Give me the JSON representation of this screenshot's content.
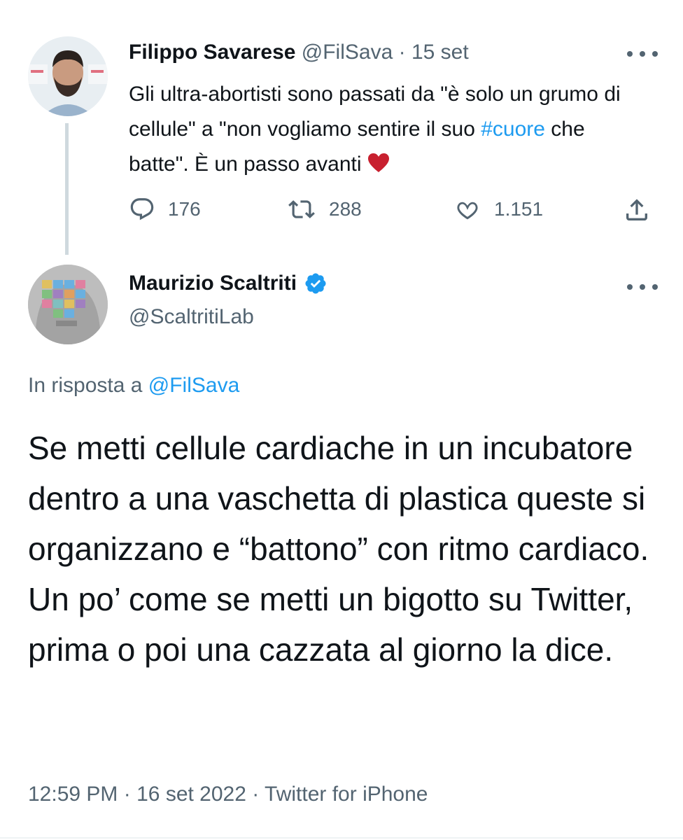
{
  "tweet1": {
    "name": "Filippo Savarese",
    "handle": "@FilSava",
    "sep": "·",
    "date": "15 set",
    "text_before": "Gli ultra-abortisti sono passati da \"è solo un grumo di cellule\" a \"non vogliamo sentire il suo ",
    "hashtag": "#cuore",
    "text_after": " che batte\". È un passo avanti ",
    "emoji_icon": "red-heart-icon",
    "replies": "176",
    "retweets": "288",
    "likes": "1.151"
  },
  "tweet2": {
    "name": "Maurizio Scaltriti",
    "handle": "@ScaltritiLab",
    "verified_icon": "verified-badge-icon",
    "reply_prefix": "In risposta a",
    "reply_handle": "@FilSava",
    "text": "Se metti cellule cardiache in un incubatore dentro a una vaschetta di plastica queste si organizzano e “battono” con ritmo cardiaco. Un po’ come se metti un bigotto su Twitter, prima o poi una cazzata al giorno la dice.",
    "time": "12:59 PM",
    "sep1": "·",
    "date": "16 set 2022",
    "sep2": "·",
    "source": "Twitter for iPhone"
  },
  "colors": {
    "link": "#1d9bf0",
    "secondary": "#536471",
    "heart": "#c8202f"
  }
}
